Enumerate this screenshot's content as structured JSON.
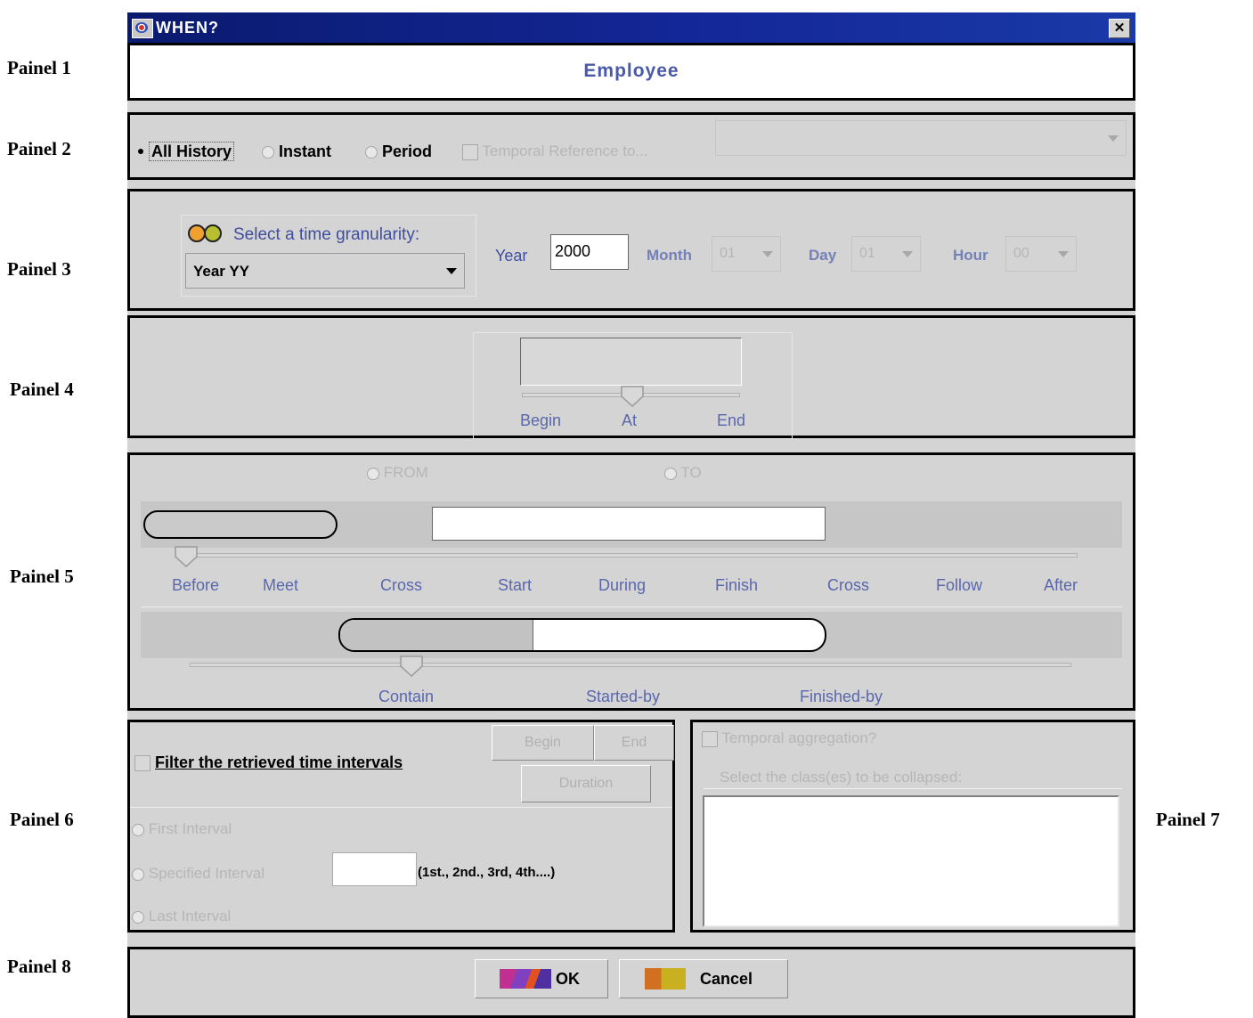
{
  "panel_labels": {
    "p1": "Painel 1",
    "p2": "Painel 2",
    "p3": "Painel 3",
    "p4": "Painel 4",
    "p5": "Painel 5",
    "p6": "Painel 6",
    "p7": "Painel 7",
    "p8": "Painel 8"
  },
  "window": {
    "title": "WHEN?"
  },
  "panel1": {
    "class_name": "Employee"
  },
  "panel2": {
    "options": [
      "All History",
      "Instant",
      "Period"
    ],
    "selected": "All History",
    "temporal_ref_label": "Temporal Reference to...",
    "temporal_ref_value": ""
  },
  "panel3": {
    "granularity_label": "Select a time granularity:",
    "granularity_value": "Year YY",
    "year_label": "Year",
    "year_value": "2000",
    "month_label": "Month",
    "month_value": "01",
    "day_label": "Day",
    "day_value": "01",
    "hour_label": "Hour",
    "hour_value": "00"
  },
  "panel4": {
    "labels": [
      "Begin",
      "At",
      "End"
    ],
    "slider_position": "At"
  },
  "panel5": {
    "from_label": "FROM",
    "to_label": "TO",
    "relation_labels": [
      "Before",
      "Meet",
      "Cross",
      "Start",
      "During",
      "Finish",
      "Cross",
      "Follow",
      "After"
    ],
    "relation_selected": "Before",
    "contain_labels": [
      "Contain",
      "Started-by",
      "Finished-by"
    ],
    "contain_selected": "Contain"
  },
  "panel6": {
    "filter_label": "Filter the retrieved time intervals",
    "begin_button": "Begin",
    "end_button": "End",
    "duration_button": "Duration",
    "first_interval": "First Interval",
    "specified_interval": "Specified Interval",
    "specified_value": "",
    "ordinal_hint": "(1st., 2nd., 3rd, 4th....)",
    "last_interval": "Last Interval"
  },
  "panel7": {
    "aggregation_label": "Temporal aggregation?",
    "collapse_label": "Select the class(es) to be collapsed:"
  },
  "panel8": {
    "ok_label": "OK",
    "cancel_label": "Cancel"
  }
}
